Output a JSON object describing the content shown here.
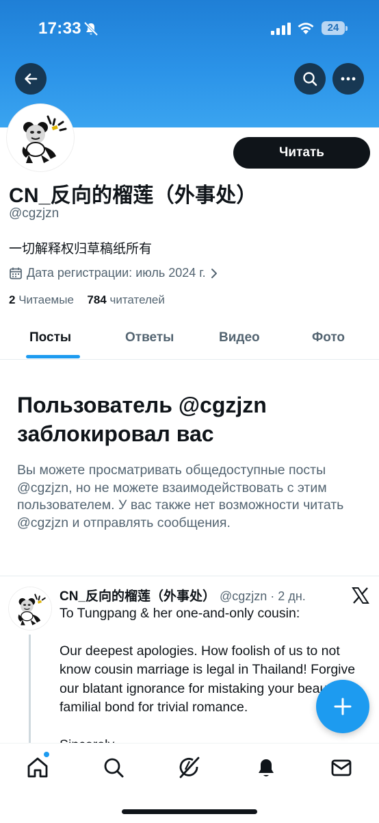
{
  "status_bar": {
    "time": "17:33",
    "battery": "24"
  },
  "profile": {
    "display_name": "CN_反向的榴莲（外事处）",
    "handle": "@cgzjzn",
    "bio": "一切解释权归草稿纸所有",
    "joined": "Дата регистрации: июль 2024 г.",
    "following_count": "2",
    "following_label": "Читаемые",
    "followers_count": "784",
    "followers_label": "читателей",
    "follow_button": "Читать"
  },
  "tabs": [
    {
      "label": "Посты",
      "active": true
    },
    {
      "label": "Ответы",
      "active": false
    },
    {
      "label": "Видео",
      "active": false
    },
    {
      "label": "Фото",
      "active": false
    }
  ],
  "blocked": {
    "title": "Пользователь @cgzjzn заблокировал вас",
    "body": "Вы можете просматривать общедоступные посты @cgzjzn, но не можете взаимодействовать с этим пользователем. У вас также нет возможности читать @cgzjzn и отправлять сообщения."
  },
  "tweet": {
    "author": "CN_反向的榴莲（外事处）",
    "meta": "@cgzjzn · 2 дн.",
    "text": "To Tungpang & her one-and-only cousin:\n\nOur deepest apologies. How foolish of us to not know cousin marriage is legal in Thailand! Forgive our blatant ignorance for mistaking your beautiful familial bond for trivial romance.\n\nSincerely,"
  },
  "colors": {
    "accent": "#1d9bf0",
    "banner": "#2b93e8",
    "text": "#0f1419",
    "muted": "#536471"
  },
  "icons": [
    "back-arrow-icon",
    "search-icon",
    "more-icon",
    "calendar-icon",
    "chevron-right-icon",
    "x-logo-icon",
    "plus-icon",
    "home-icon",
    "explore-icon",
    "grok-icon",
    "notifications-icon",
    "messages-icon"
  ]
}
